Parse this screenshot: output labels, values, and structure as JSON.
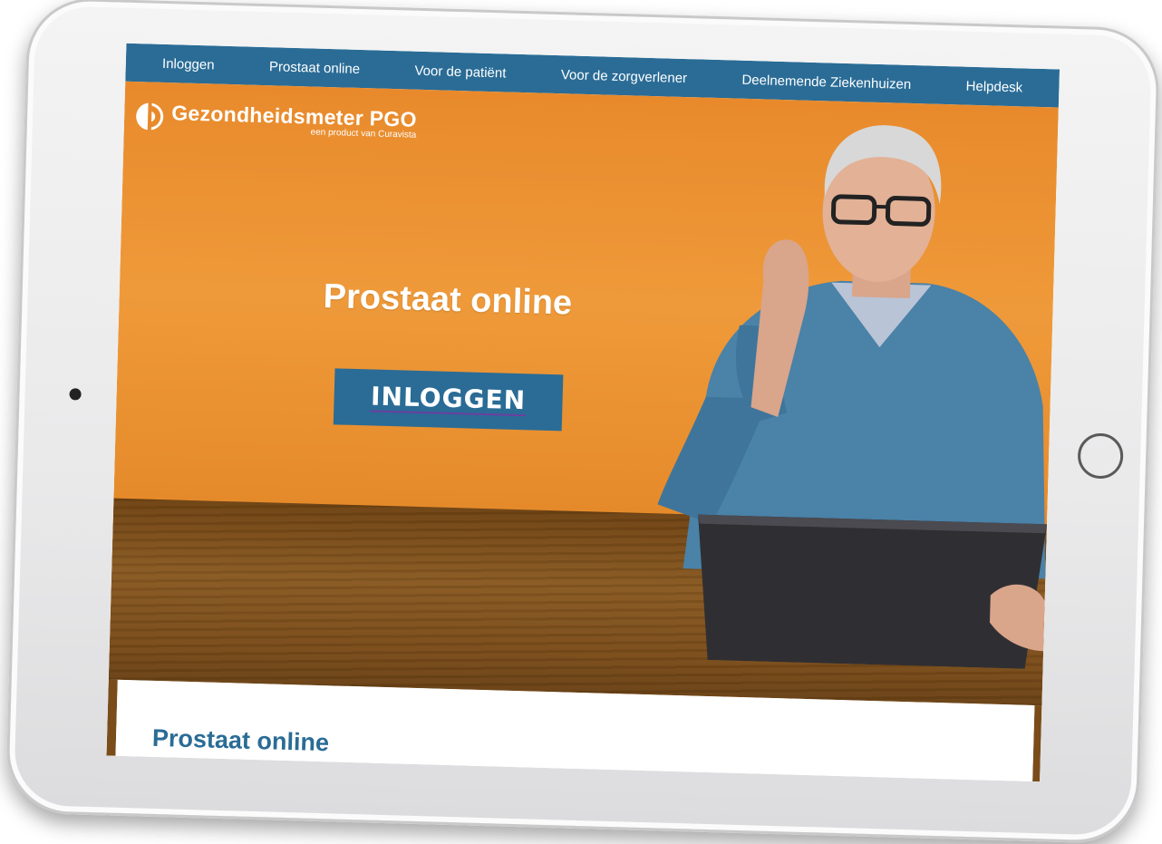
{
  "nav": {
    "items": [
      {
        "label": "Inloggen"
      },
      {
        "label": "Prostaat online"
      },
      {
        "label": "Voor de patiënt"
      },
      {
        "label": "Voor de zorgverlener"
      },
      {
        "label": "Deelnemende Ziekenhuizen"
      },
      {
        "label": "Helpdesk"
      }
    ]
  },
  "logo": {
    "title": "Gezondheidsmeter PGO",
    "subtitle": "een product van Curavista"
  },
  "hero": {
    "title": "Prostaat online",
    "login_label": "INLOGGEN"
  },
  "content": {
    "title": "Prostaat online"
  },
  "colors": {
    "nav_blue": "#2a6c96",
    "hero_orange": "#ef9a3a",
    "table_brown": "#7a4c1a",
    "sweater_blue": "#4a82a8"
  }
}
